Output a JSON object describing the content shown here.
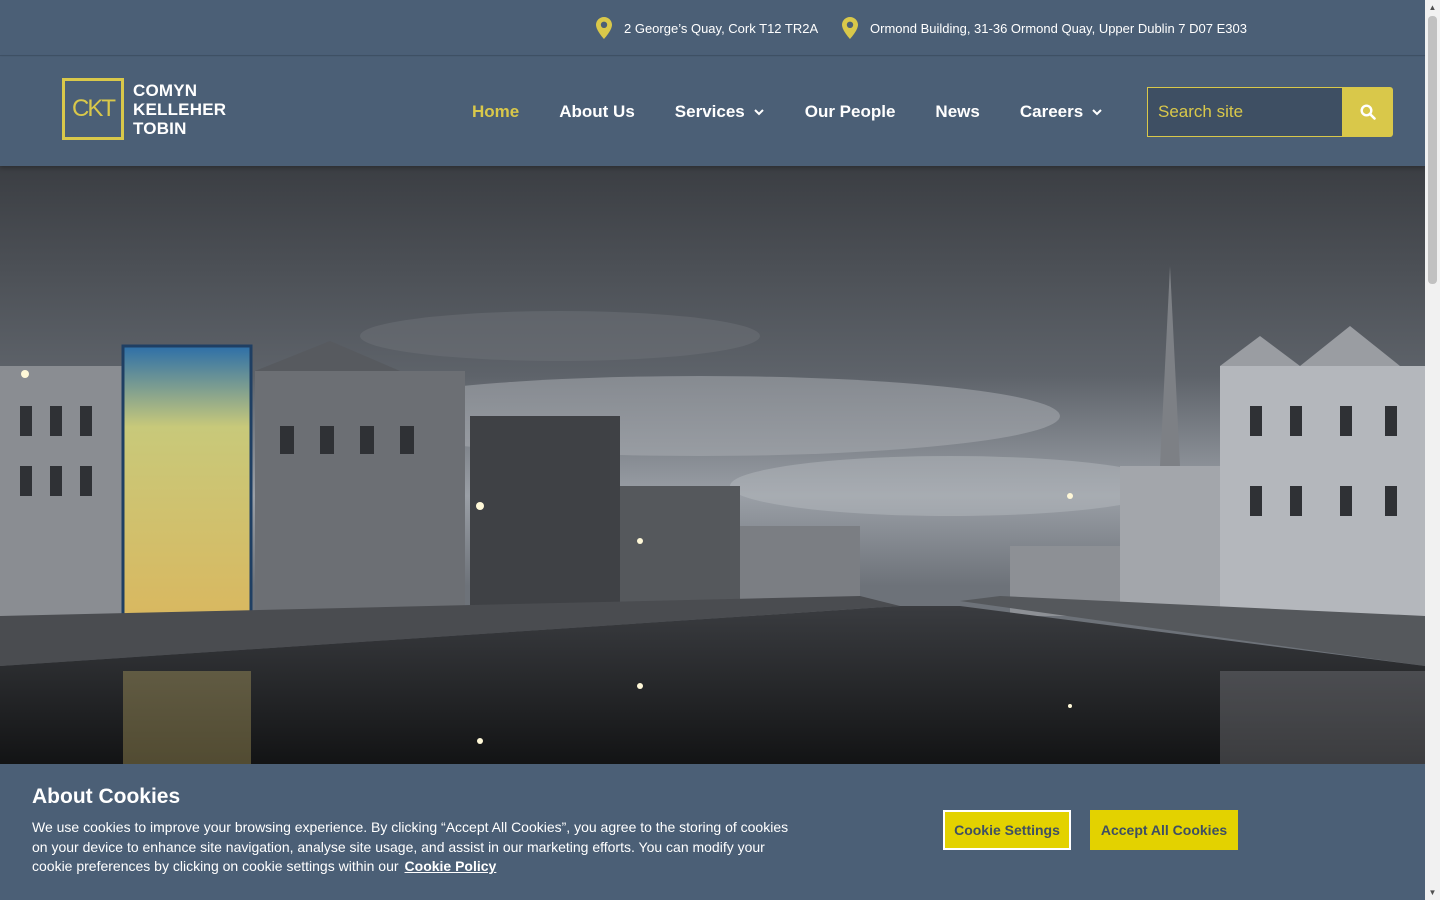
{
  "topbar": {
    "address_cork": "2 George’s Quay, Cork T12 TR2A",
    "address_dublin": "Ormond Building, 31-36 Ormond Quay, Upper Dublin 7 D07 E303"
  },
  "logo": {
    "mark": "CKT",
    "line1": "COMYN",
    "line2": "KELLEHER",
    "line3": "TOBIN"
  },
  "nav": {
    "items": [
      {
        "label": "Home",
        "active": true
      },
      {
        "label": "About Us"
      },
      {
        "label": "Services",
        "has_dropdown": true
      },
      {
        "label": "Our People"
      },
      {
        "label": "News"
      },
      {
        "label": "Careers",
        "has_dropdown": true
      }
    ]
  },
  "search": {
    "placeholder": "Search site",
    "icon": "search-icon"
  },
  "colors": {
    "brand_blue": "#4b5f76",
    "accent_gold": "#d9c84a",
    "button_yellow": "#e3d200"
  },
  "cookie": {
    "title": "About Cookies",
    "body": "We use cookies to improve your browsing experience. By clicking “Accept All Cookies”, you agree to the storing of cookies on your device to enhance site navigation, analyse site usage, and assist in our marketing efforts. You can modify your cookie preferences by clicking on cookie settings within our",
    "link": "Cookie Policy",
    "settings_label": "Cookie Settings",
    "accept_label": "Accept All Cookies"
  }
}
